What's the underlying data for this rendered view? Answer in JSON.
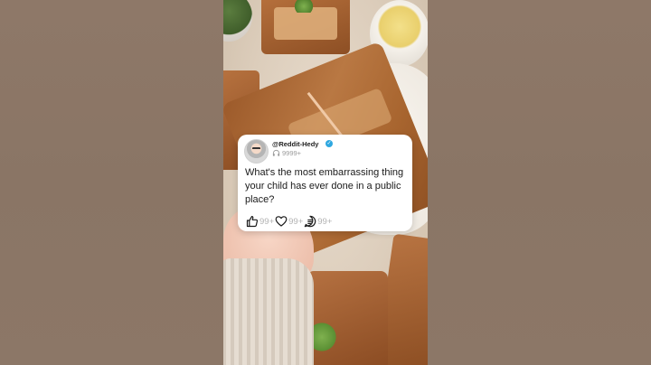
{
  "post": {
    "username": "@Reddit-Hedy",
    "listens": "9999+",
    "question": "What's the most embarrassing thing your child has ever done in a public place?",
    "likes": "99+",
    "hearts": "99+",
    "comments": "99+"
  },
  "icons": {
    "verified": "verified-badge-icon",
    "listens": "headphones-icon",
    "likes": "thumbs-up-icon",
    "hearts": "heart-icon",
    "comments": "comment-icon"
  },
  "colors": {
    "verified": "#2ea7e0",
    "count_text": "#b2b2b2",
    "card_background": "#ffffff"
  }
}
